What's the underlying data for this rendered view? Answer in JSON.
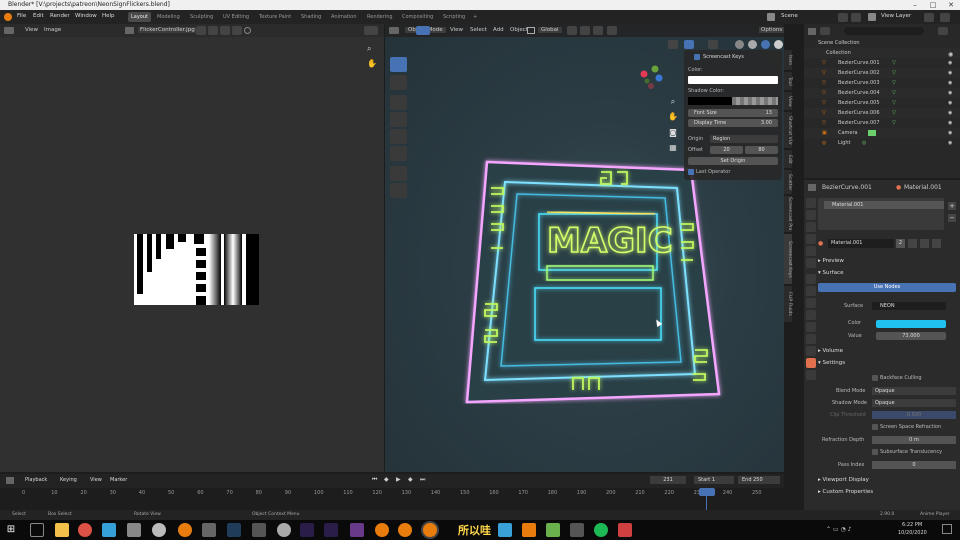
{
  "window": {
    "title": "Blender* [V:\\projects\\patreon\\NeonSignFlickers.blend]",
    "minimize": "–",
    "maximize": "□",
    "close": "✕"
  },
  "menu": {
    "items": [
      "File",
      "Edit",
      "Render",
      "Window",
      "Help"
    ]
  },
  "workspaces": [
    "Layout",
    "Modeling",
    "Sculpting",
    "UV Editing",
    "Texture Paint",
    "Shading",
    "Animation",
    "Rendering",
    "Compositing",
    "Scripting",
    "+"
  ],
  "scene": {
    "label": "Scene",
    "view_layer": "View Layer"
  },
  "image_editor": {
    "menus": [
      "View",
      "Image"
    ],
    "image_name": "FlickerController.jpg"
  },
  "viewport": {
    "mode": "Object Mode",
    "menus": [
      "View",
      "Select",
      "Add",
      "Object"
    ],
    "transform": "Global",
    "options": "Options",
    "sign_text": "MAGIC"
  },
  "npanel": {
    "title": "Screencast Keys",
    "color_label": "Color:",
    "shadow_label": "Shadow Color:",
    "font_size_label": "Font Size",
    "font_size": "13",
    "display_time_label": "Display Time",
    "display_time": "3.00",
    "origin_label": "Origin",
    "origin_value": "Region",
    "offset_label": "Offset",
    "offset_x": "20",
    "offset_y": "80",
    "set_origin": "Set Origin",
    "last_operator": "Last Operator",
    "tabs": [
      "Item",
      "Tool",
      "View",
      "Shortcut VUr",
      "Edit",
      "Scatter",
      "Screencast Pro",
      "Screencast Keys",
      "FLIP Fluids"
    ]
  },
  "outliner": {
    "root": "Scene Collection",
    "collection": "Collection",
    "items": [
      "BezierCurve.001",
      "BezierCurve.002",
      "BezierCurve.003",
      "BezierCurve.004",
      "BezierCurve.005",
      "BezierCurve.006",
      "BezierCurve.007",
      "Camera",
      "Light"
    ]
  },
  "properties": {
    "object": "BezierCurve.001",
    "material_header": "Material.001",
    "slot": "Material.001",
    "material_field": "Material.001",
    "users": "2",
    "preview": "Preview",
    "surface": "Surface",
    "use_nodes": "Use Nodes",
    "surface_label": "Surface",
    "surface_value": "NEON",
    "color_label": "Color",
    "value_label": "Value",
    "value": "73.000",
    "volume": "Volume",
    "settings": "Settings",
    "backface": "Backface Culling",
    "blend_mode_label": "Blend Mode",
    "blend_mode": "Opaque",
    "shadow_mode_label": "Shadow Mode",
    "shadow_mode": "Opaque",
    "clip_label": "Clip Threshold",
    "clip_value": "0.500",
    "ssr": "Screen Space Refraction",
    "refraction_label": "Refraction Depth",
    "refraction": "0 m",
    "subsurface": "Subsurface Translucency",
    "pass_label": "Pass Index",
    "pass": "0",
    "viewport_display": "Viewport Display",
    "custom_props": "Custom Properties",
    "accent_color": "#1ec3f0"
  },
  "timeline": {
    "menus": [
      "Playback",
      "Keying",
      "View",
      "Marker"
    ],
    "current": "231",
    "start_label": "Start",
    "start": "1",
    "end_label": "End",
    "end": "250",
    "ticks": [
      "0",
      "10",
      "20",
      "30",
      "40",
      "50",
      "60",
      "70",
      "80",
      "90",
      "100",
      "110",
      "120",
      "130",
      "140",
      "150",
      "160",
      "170",
      "180",
      "190",
      "200",
      "210",
      "220",
      "230",
      "240",
      "250"
    ]
  },
  "status": {
    "select": "Select",
    "box_select": "Box Select",
    "rotate": "Rotate View",
    "context": "Object Context Menu",
    "version": "2.90.0",
    "anime": "Anime Player"
  },
  "taskbar": {
    "time": "6:22 PM",
    "date": "10/20/2020",
    "cjk": "所以哇"
  }
}
